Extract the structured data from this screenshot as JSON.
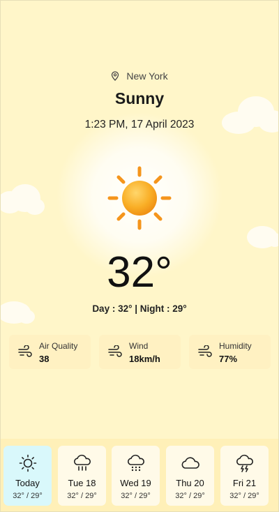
{
  "location": {
    "city": "New York",
    "icon": "location-pin-icon"
  },
  "weather": {
    "condition": "Sunny",
    "datetime": "1:23 PM, 17 April 2023",
    "temperature": "32°",
    "day_night": "Day : 32° | Night : 29°",
    "icon": "sun-icon"
  },
  "stats": [
    {
      "label": "Air Quality",
      "value": "38",
      "icon": "wind-icon"
    },
    {
      "label": "Wind",
      "value": "18km/h",
      "icon": "wind-icon"
    },
    {
      "label": "Humidity",
      "value": "77%",
      "icon": "wind-icon"
    }
  ],
  "forecast": [
    {
      "day": "Today",
      "range": "32° / 29°",
      "icon": "sun-outline-icon",
      "active": true
    },
    {
      "day": "Tue 18",
      "range": "32° / 29°",
      "icon": "rain-cloud-icon"
    },
    {
      "day": "Wed 19",
      "range": "32° / 29°",
      "icon": "snow-cloud-icon"
    },
    {
      "day": "Thu 20",
      "range": "32° / 29°",
      "icon": "cloud-icon"
    },
    {
      "day": "Fri 21",
      "range": "32° / 29°",
      "icon": "storm-cloud-icon"
    }
  ],
  "colors": {
    "background": "#FFF6C9",
    "card": "#FFF1C2",
    "active_day": "#D9F8FB",
    "sun": "#F7A21B"
  }
}
